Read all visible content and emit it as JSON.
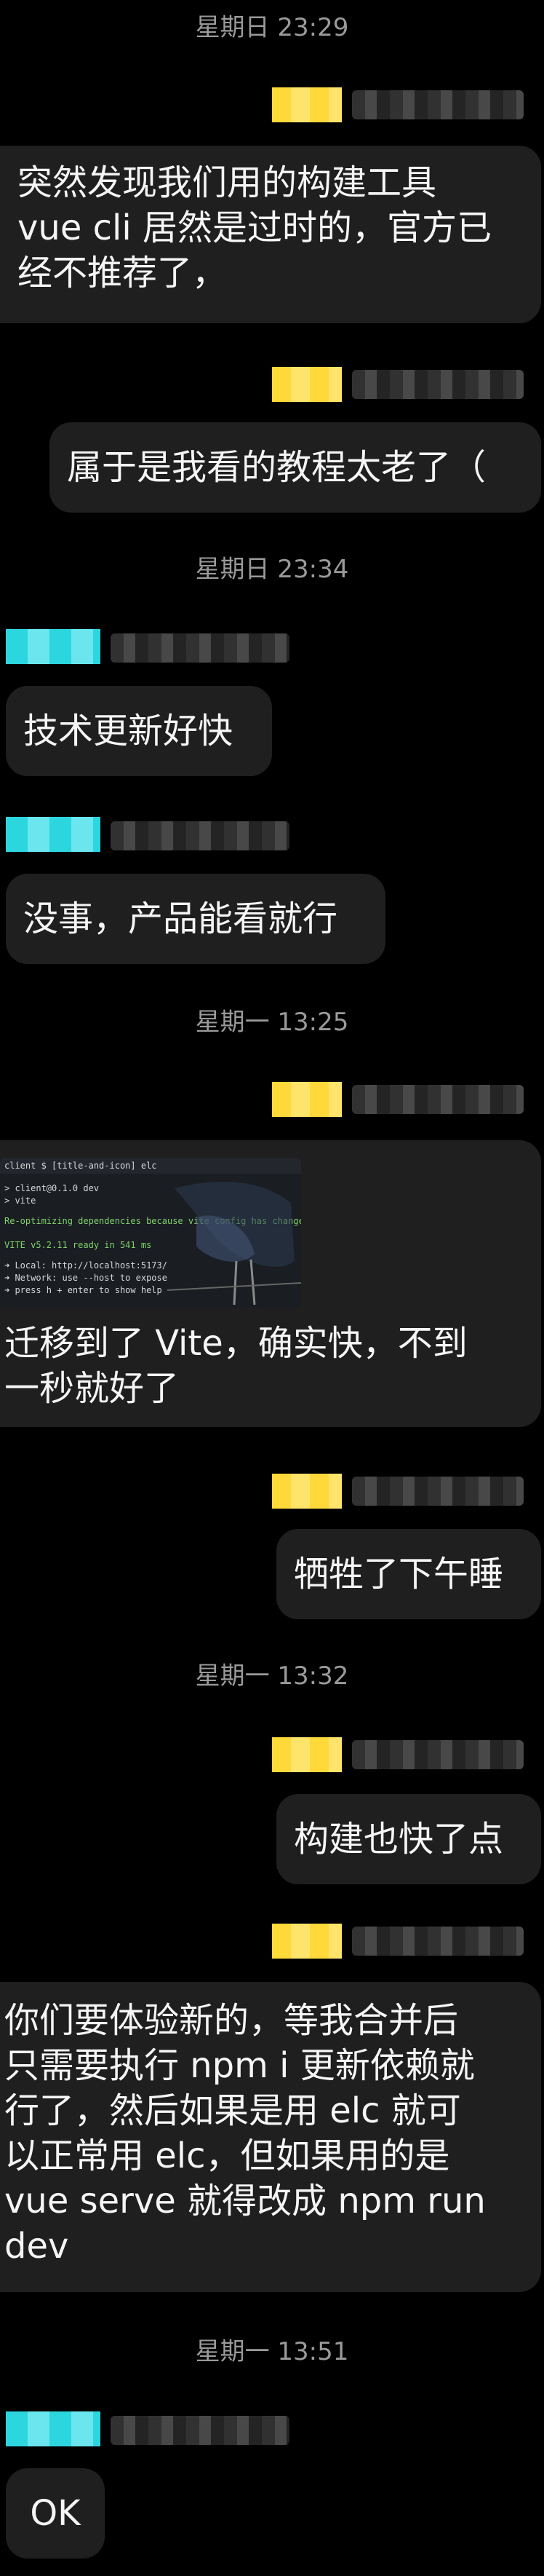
{
  "messages": {
    "t1": "星期日 23:29",
    "m1": [
      "突然发现我们用的构建工具",
      "vue cli 居然是过时的，官方已",
      "经不推荐了，"
    ],
    "m2": "属于是我看的教程太老了（",
    "t2": "星期日 23:34",
    "m3": "技术更新好快",
    "m4": "没事，产品能看就行",
    "t3": "星期一 13:25",
    "m5": [
      "迁移到了 Vite，确实快，不到",
      "一秒就好了"
    ],
    "m6": "牺牲了下午睡",
    "t4": "星期一 13:32",
    "m7": "构建也快了点",
    "m8": [
      "你们要体验新的，等我合并后",
      "只需要执行 npm i 更新依赖就",
      "行了，然后如果是用 elc 就可",
      "以正常用 elc，但如果用的是",
      "vue serve 就得改成 npm run",
      "dev"
    ],
    "t5": "星期一 13:51",
    "m9": "OK"
  },
  "terminal": {
    "title": "client $ [title-and-icon] elc",
    "l1": "> client@0.1.0 dev",
    "l2": "> vite",
    "l3": "Re-optimizing dependencies because vite config has changed",
    "l4": "VITE v5.2.11  ready in 541 ms",
    "l5": "➜  Local:   http://localhost:5173/",
    "l6": "➜  Network: use --host to expose",
    "l7": "➜  press h + enter to show help"
  },
  "colors": {
    "background": "#000000",
    "bubble": "#1f1f1f",
    "self_tag": "#ffd83a",
    "other_tag": "#2cd6df"
  }
}
